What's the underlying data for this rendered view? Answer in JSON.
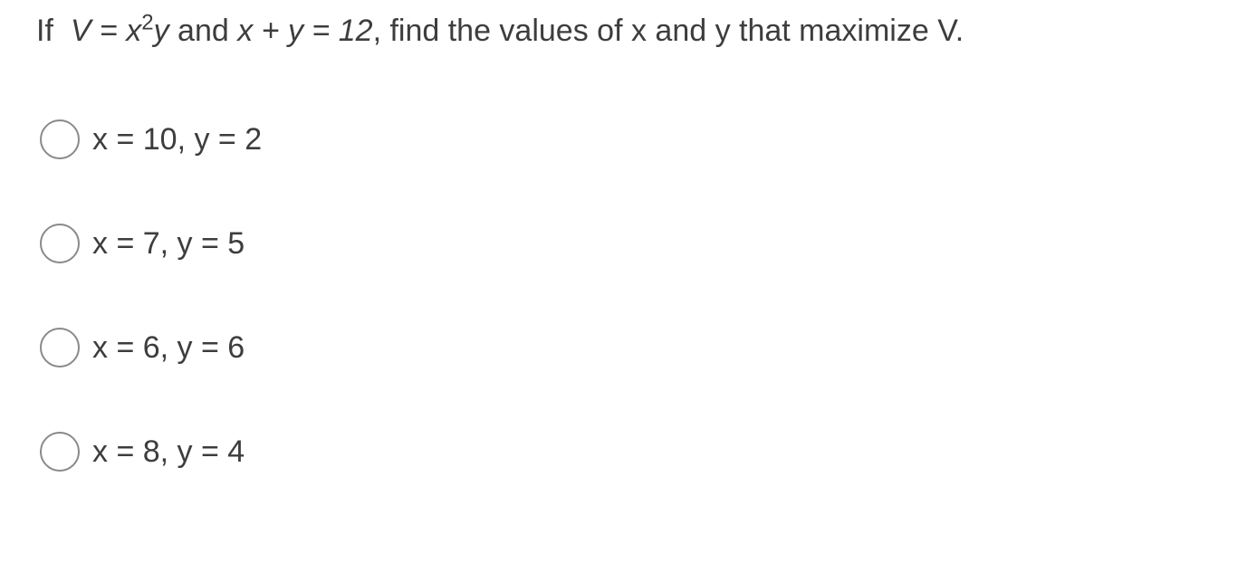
{
  "question": {
    "prefix": "If",
    "formula_v": "V = x",
    "exponent": "2",
    "formula_y": "y",
    "mid": " and ",
    "constraint": "x + y = 12",
    "suffix": ", find the values of x and y that maximize V."
  },
  "options": [
    {
      "label": "x = 10, y = 2",
      "selected": false
    },
    {
      "label": "x = 7, y = 5",
      "selected": false
    },
    {
      "label": "x = 6, y = 6",
      "selected": false
    },
    {
      "label": "x = 8, y = 4",
      "selected": false
    }
  ]
}
